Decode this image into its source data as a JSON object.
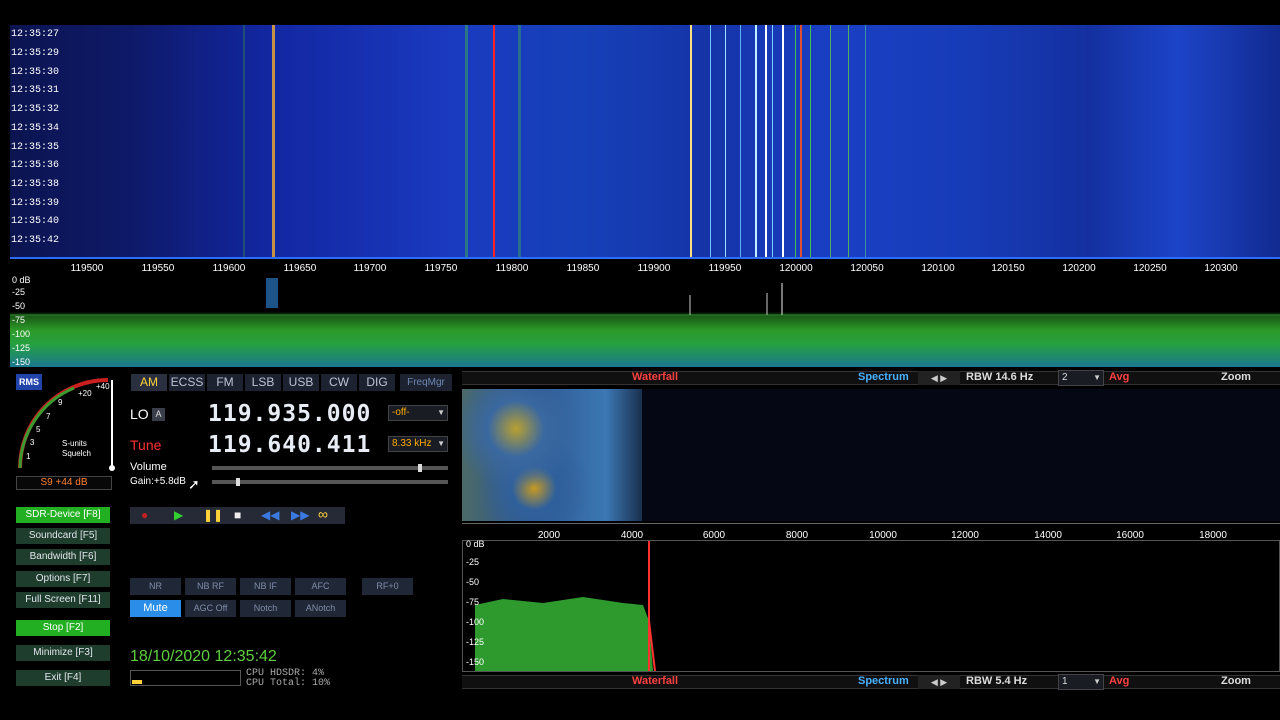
{
  "waterfall": {
    "timestamps": [
      "12:35:27",
      "12:35:29",
      "12:35:30",
      "12:35:31",
      "12:35:32",
      "12:35:34",
      "12:35:35",
      "12:35:36",
      "12:35:38",
      "12:35:39",
      "12:35:40",
      "12:35:42"
    ],
    "freq_labels": [
      "119500",
      "119550",
      "119600",
      "119650",
      "119700",
      "119750",
      "119800",
      "119850",
      "119900",
      "119950",
      "120000",
      "120050",
      "120100",
      "120150",
      "120200",
      "120250",
      "120300"
    ]
  },
  "spectrum": {
    "db_labels": [
      "0 dB",
      "-25",
      "-50",
      "-75",
      "-100",
      "-125",
      "-150"
    ]
  },
  "smeter": {
    "rms_label": "RMS",
    "scale_labels": [
      "+20",
      "+40",
      "9",
      "7",
      "5",
      "3",
      "1"
    ],
    "caption_1": "S-units",
    "caption_2": "Squelch",
    "reading": "S9 +44 dB"
  },
  "modes": [
    "AM",
    "ECSS",
    "FM",
    "LSB",
    "USB",
    "CW",
    "DIG",
    "FreqMgr"
  ],
  "active_mode": "AM",
  "lo": {
    "label": "LO",
    "tag": "A",
    "frequency": "119.935.000",
    "dropdown": "-off-"
  },
  "tune": {
    "label": "Tune",
    "frequency": "119.640.411",
    "dropdown": "8.33 kHz"
  },
  "volume_label": "Volume",
  "gain_label": "Gain:+5.8dB",
  "menu": [
    {
      "label": "SDR-Device [F8]",
      "highlight": true
    },
    {
      "label": "Soundcard  [F5]",
      "highlight": false
    },
    {
      "label": "Bandwidth  [F6]",
      "highlight": false
    },
    {
      "label": "Options  [F7]",
      "highlight": false
    },
    {
      "label": "Full Screen [F11]",
      "highlight": false
    },
    {
      "label": "Stop  [F2]",
      "highlight": true
    },
    {
      "label": "Minimize  [F3]",
      "highlight": false
    },
    {
      "label": "Exit  [F4]",
      "highlight": false
    }
  ],
  "dsp_row1": [
    "NR",
    "NB RF",
    "NB IF",
    "AFC",
    "RF+0"
  ],
  "dsp_row2": [
    "Mute",
    "AGC Off",
    "Notch",
    "ANotch"
  ],
  "datetime": "18/10/2020 12:35:42",
  "cpu_hdsdr": "CPU HDSDR:  4%",
  "cpu_total": "CPU Total: 10%",
  "top_toolbar": {
    "waterfall": "Waterfall",
    "spectrum": "Spectrum",
    "rbw": "RBW 14.6 Hz",
    "avg_value": "2",
    "avg": "Avg",
    "zoom": "Zoom"
  },
  "bottom_toolbar": {
    "waterfall": "Waterfall",
    "spectrum": "Spectrum",
    "rbw": "RBW  5.4 Hz",
    "avg_value": "1",
    "avg": "Avg",
    "zoom": "Zoom"
  },
  "af_axis_labels": [
    "2000",
    "4000",
    "6000",
    "8000",
    "10000",
    "12000",
    "14000",
    "16000",
    "18000"
  ],
  "af_db_labels": [
    "0 dB",
    "-25",
    "-50",
    "-75",
    "-100",
    "-125",
    "-150"
  ],
  "colors": {
    "accent_green": "#22b022",
    "accent_yellow": "#ffd23a",
    "tune_red": "#ff3030",
    "mute_blue": "#2a8ee8"
  }
}
